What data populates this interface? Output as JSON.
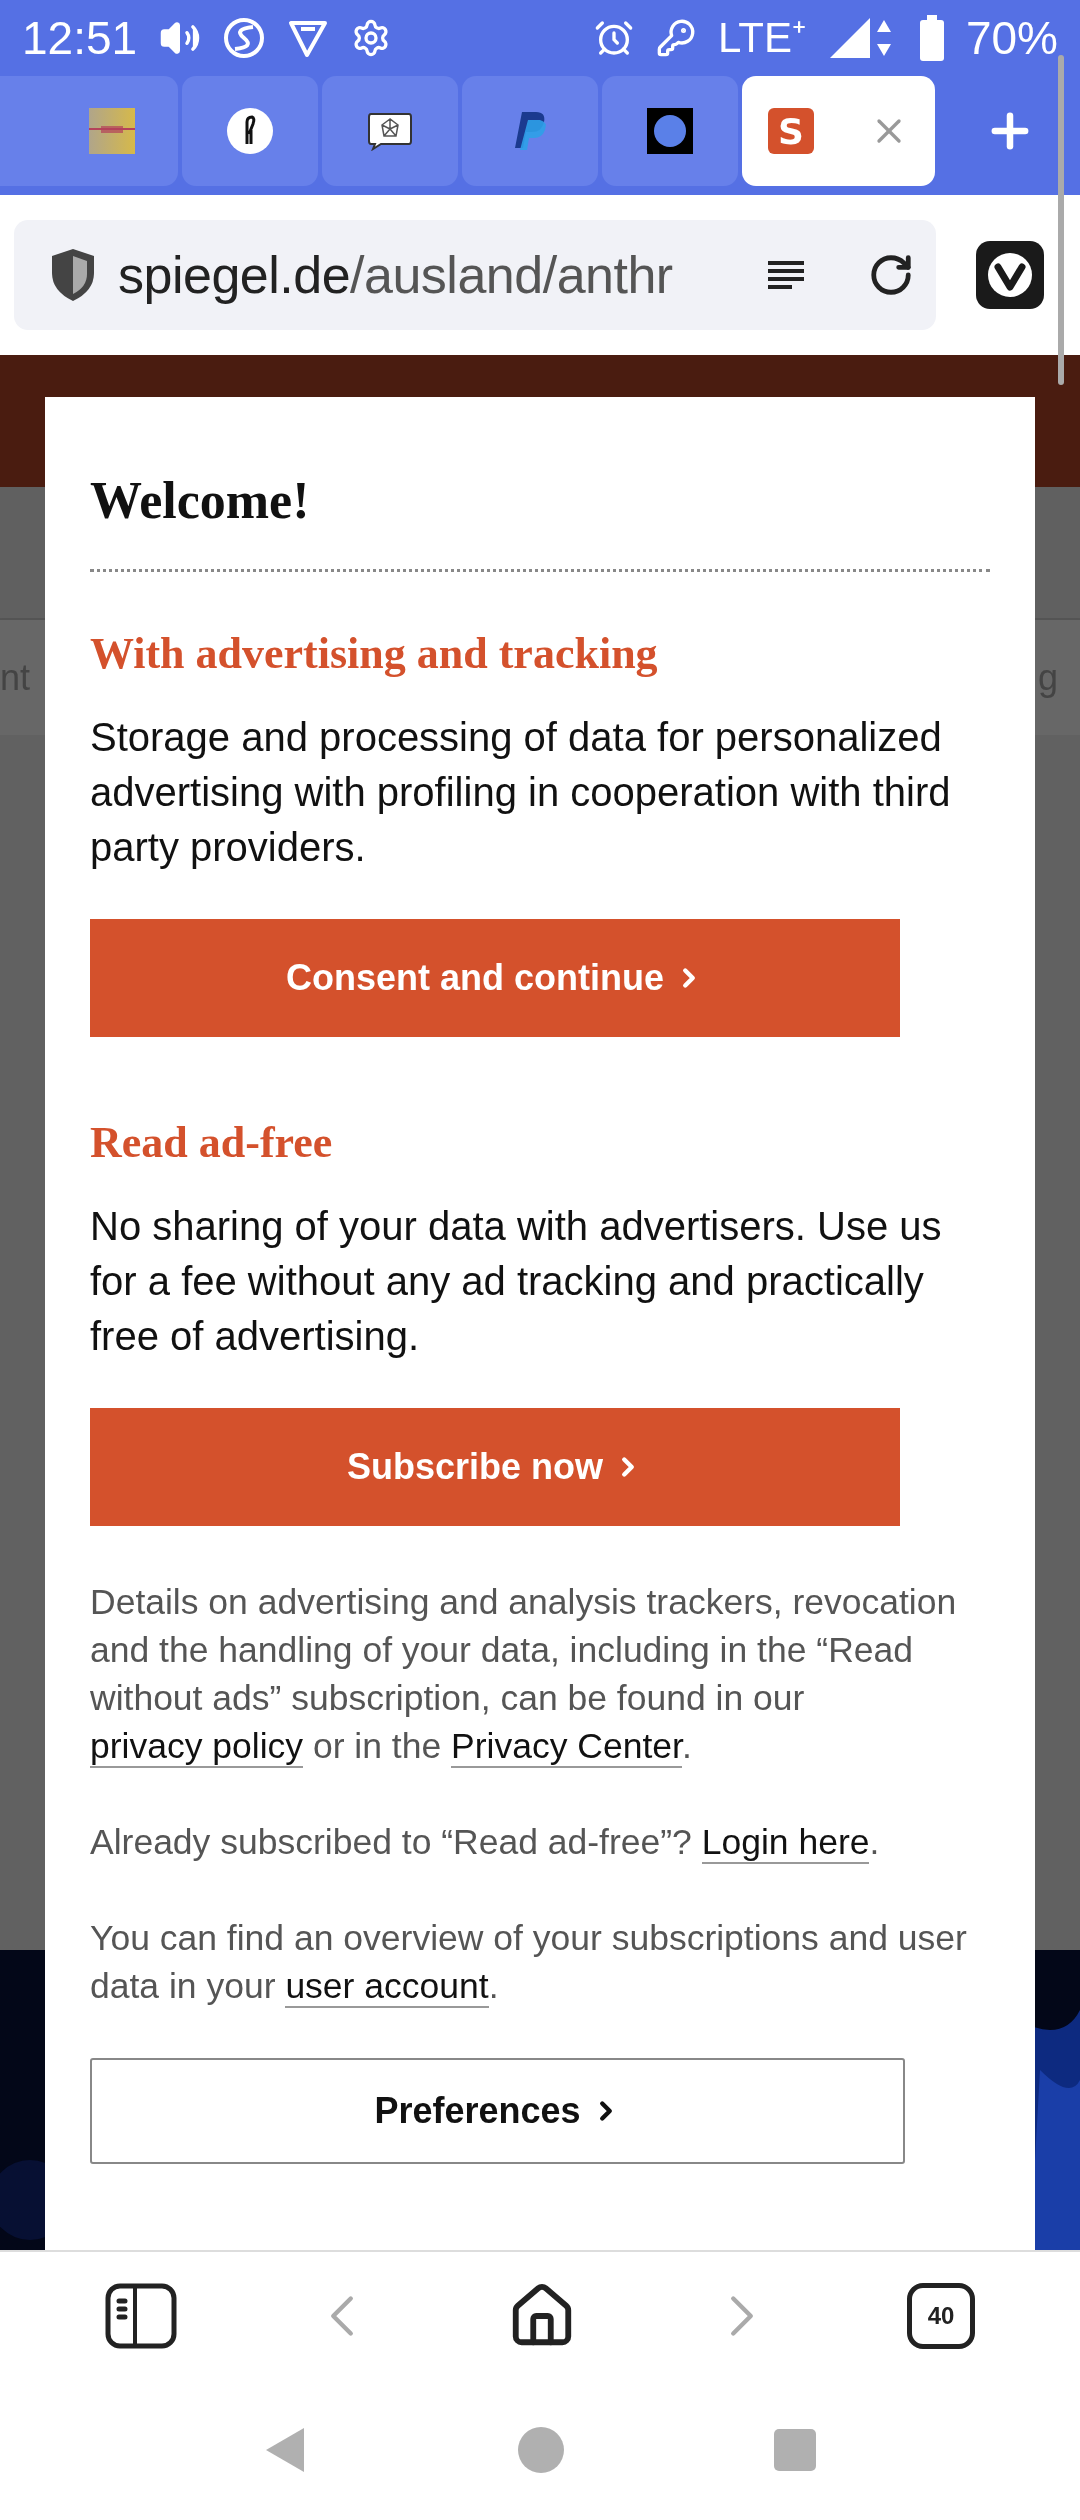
{
  "status_bar": {
    "time": "12:51",
    "network": "LTE⁺",
    "battery": "70%"
  },
  "tabs": [
    {
      "kind": "stripes",
      "selected": false
    },
    {
      "kind": "glyph-circle",
      "selected": false
    },
    {
      "kind": "network",
      "selected": false
    },
    {
      "kind": "shapes",
      "selected": false
    },
    {
      "kind": "dot",
      "selected": false
    },
    {
      "kind": "letter",
      "favicon_text": "S",
      "selected": true
    }
  ],
  "address_bar": {
    "host": "spiegel.de",
    "path": "/ausland/anthr"
  },
  "background": {
    "fragments": [
      "nt",
      "g"
    ]
  },
  "consent": {
    "title": "Welcome!",
    "sections": [
      {
        "heading": "With advertising and tracking",
        "text": "Storage and processing of data for personalized advertising with profiling in cooperation with third party providers.",
        "button": "Consent and continue"
      },
      {
        "heading": "Read ad-free",
        "text": "No sharing of your data with advertisers. Use us for a fee without any ad tracking and practically free of advertising.",
        "button": "Subscribe now"
      }
    ],
    "notes": [
      {
        "parts": [
          {
            "text": "Details on advertising and analysis trackers, revocation and the handling of your data, including in the “Read without ads” subscription, can be found in our "
          },
          {
            "link": "privacy policy"
          },
          {
            "text": " or in the "
          },
          {
            "link": "Privacy Center"
          },
          {
            "text": "."
          }
        ]
      },
      {
        "parts": [
          {
            "text": "Already subscribed to “Read ad-free”? "
          },
          {
            "link": "Login here"
          },
          {
            "text": "."
          }
        ]
      },
      {
        "parts": [
          {
            "text": "You can find an overview of your subscriptions and user data in your "
          },
          {
            "link": "user account"
          },
          {
            "text": "."
          }
        ]
      }
    ],
    "preferences_button": "Preferences"
  },
  "toolbar": {
    "tab_count": "40"
  }
}
